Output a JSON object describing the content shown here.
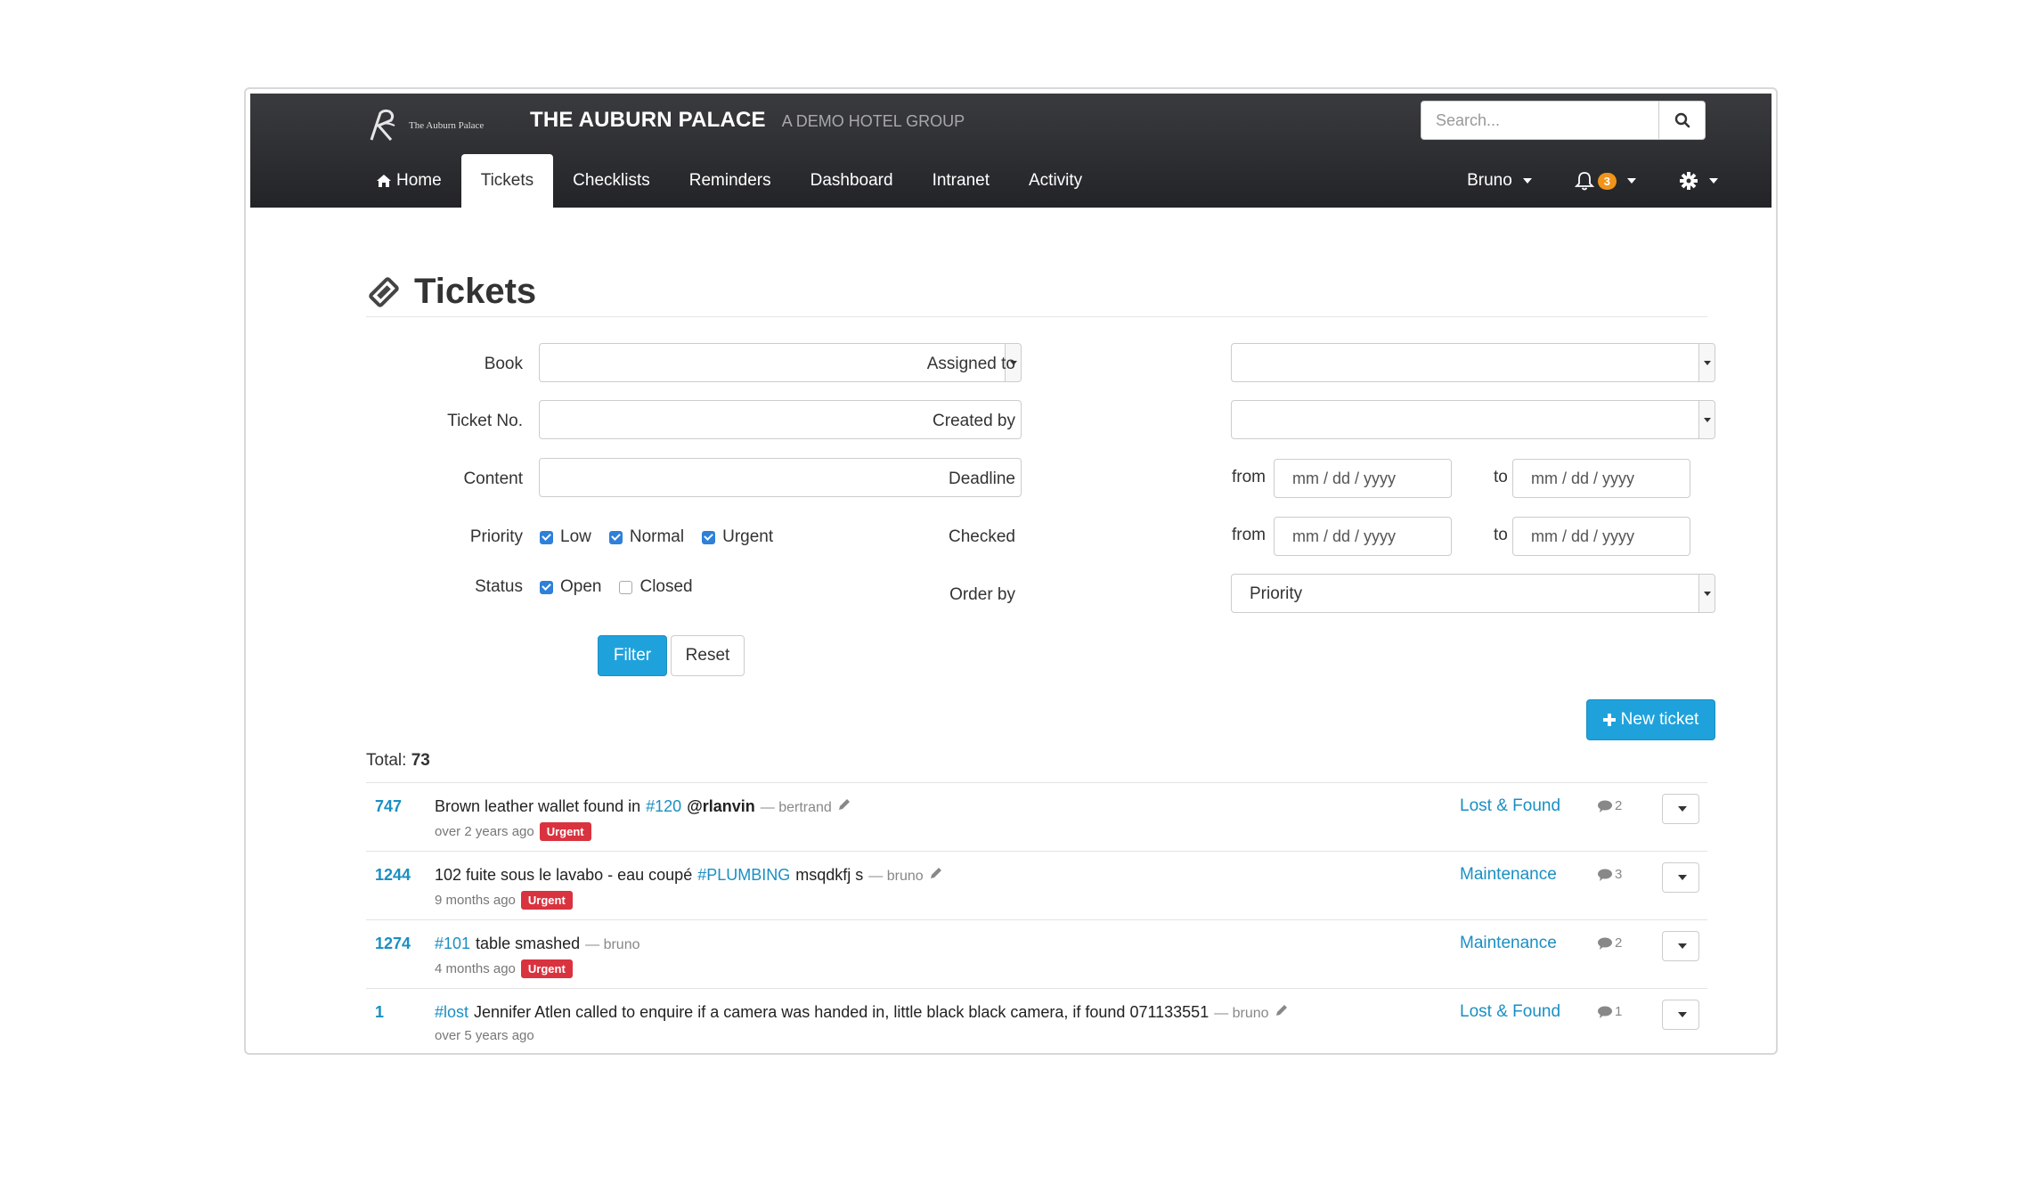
{
  "header": {
    "logo_text": "The Auburn Palace",
    "brand_name": "THE AUBURN PALACE",
    "brand_sub": "A DEMO HOTEL GROUP",
    "search_placeholder": "Search..."
  },
  "nav": {
    "items": [
      "Home",
      "Tickets",
      "Checklists",
      "Reminders",
      "Dashboard",
      "Intranet",
      "Activity"
    ],
    "active": "Tickets",
    "user": "Bruno",
    "notifications": "3"
  },
  "page": {
    "title": "Tickets"
  },
  "filters": {
    "book_label": "Book",
    "ticket_no_label": "Ticket No.",
    "content_label": "Content",
    "priority_label": "Priority",
    "priority_options": [
      "Low",
      "Normal",
      "Urgent"
    ],
    "status_label": "Status",
    "status_options": [
      "Open",
      "Closed"
    ],
    "assigned_to_label": "Assigned to",
    "created_by_label": "Created by",
    "deadline_label": "Deadline",
    "checked_label": "Checked",
    "from_label": "from",
    "to_label": "to",
    "date_placeholder": "mm / dd / yyyy",
    "order_by_label": "Order by",
    "order_by_value": "Priority",
    "filter_button": "Filter",
    "reset_button": "Reset"
  },
  "new_ticket_button": "New ticket",
  "total_label": "Total:",
  "total_value": "73",
  "tickets": [
    {
      "id": "747",
      "text": "Brown leather wallet found in",
      "tag": "#120",
      "mention": "@rlanvin",
      "after": "",
      "author": "— bertrand",
      "age": "over 2 years ago",
      "badge": "Urgent",
      "category": "Lost & Found",
      "comments": "2"
    },
    {
      "id": "1244",
      "text": "102 fuite sous le lavabo - eau coupé",
      "tag": "#PLUMBING",
      "mention": "",
      "after": "msqdkfj s",
      "author": "— bruno",
      "age": "9 months ago",
      "badge": "Urgent",
      "category": "Maintenance",
      "comments": "3"
    },
    {
      "id": "1274",
      "text": "",
      "tag": "#101",
      "mention": "",
      "after": "table smashed",
      "author": "— bruno",
      "age": "4 months ago",
      "badge": "Urgent",
      "category": "Maintenance",
      "comments": "2"
    },
    {
      "id": "1",
      "text": "",
      "tag": "#lost",
      "mention": "",
      "after": "Jennifer Atlen called to enquire if a camera was handed in, little black black camera, if found 071133551",
      "author": "— bruno",
      "age": "over 5 years ago",
      "badge": "",
      "category": "Lost & Found",
      "comments": "1"
    }
  ]
}
